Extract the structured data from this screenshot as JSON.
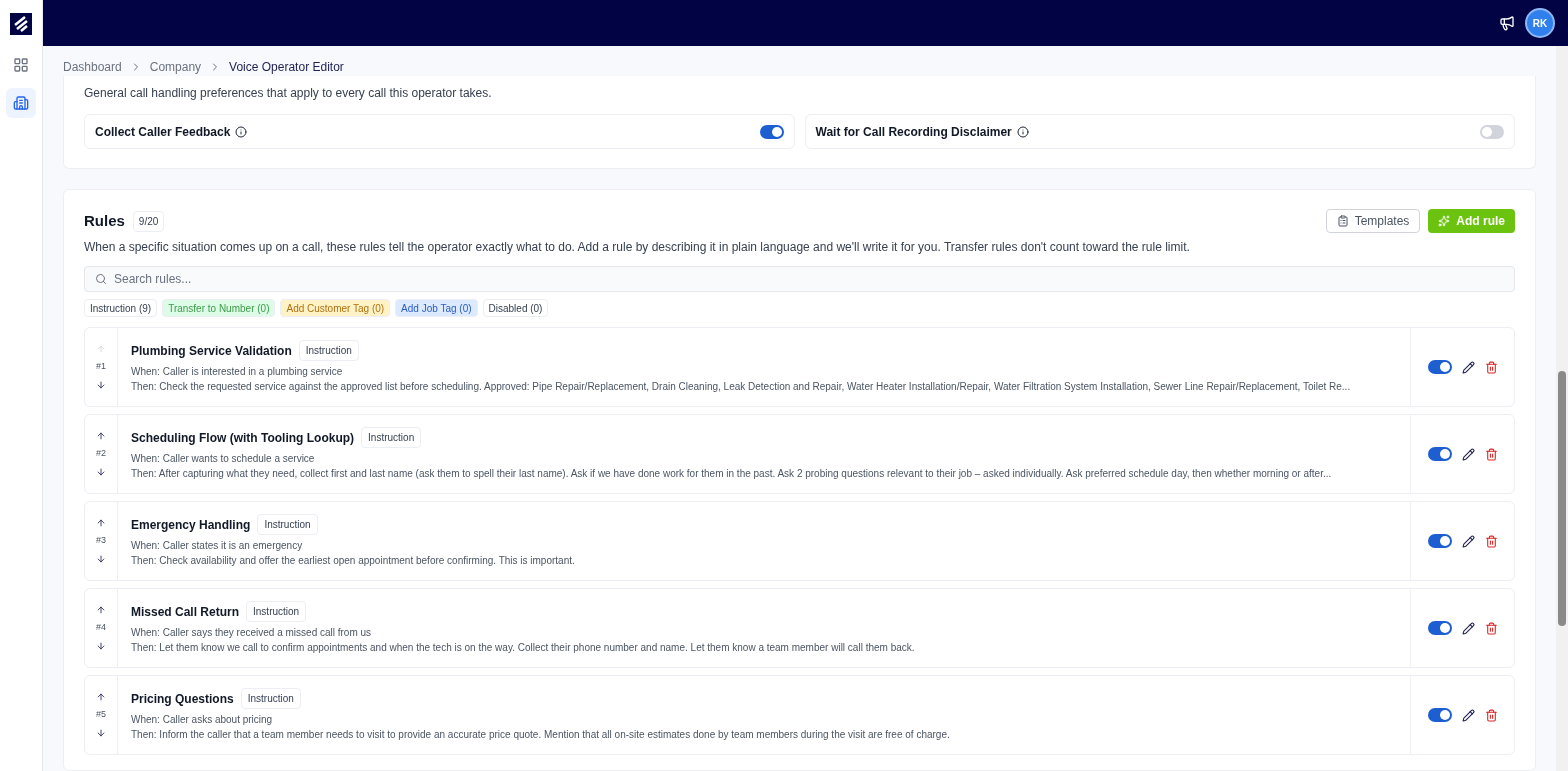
{
  "topbar": {
    "avatar": "RK"
  },
  "sidebar": {
    "items": [
      {
        "kind": "grid",
        "selected": false
      },
      {
        "kind": "building",
        "selected": true
      }
    ]
  },
  "breadcrumb": [
    "Dashboard",
    "Company",
    "Voice Operator Editor"
  ],
  "preferences": {
    "description": "General call handling preferences that apply to every call this operator takes.",
    "settings": [
      {
        "label": "Collect Caller Feedback",
        "on": true
      },
      {
        "label": "Wait for Call Recording Disclaimer",
        "on": false
      }
    ]
  },
  "rules": {
    "title": "Rules",
    "count": "9/20",
    "description": "When a specific situation comes up on a call, these rules tell the operator exactly what to do. Add a rule by describing it in plain language and we'll write it for you. Transfer rules don't count toward the rule limit.",
    "templates_button": "Templates",
    "add_button": "Add rule",
    "search": {
      "placeholder": "Search rules..."
    },
    "filters": [
      {
        "label": "Instruction (9)",
        "color": "#ffffff"
      },
      {
        "label": "Transfer to Number (0)",
        "color": "#dcfce7"
      },
      {
        "label": "Add Customer Tag (0)",
        "color": "#fef3c7"
      },
      {
        "label": "Add Job Tag (0)",
        "color": "#dbeafe"
      },
      {
        "label": "Disabled (0)",
        "color": "#ffffff"
      }
    ],
    "items": [
      {
        "number": "#1",
        "up_disabled": true,
        "title": "Plumbing Service Validation",
        "type": "Instruction",
        "when": "When: Caller is interested in a plumbing service",
        "then": "Then: Check the requested service against the approved list before scheduling. Approved: Pipe Repair/Replacement, Drain Cleaning, Leak Detection and Repair, Water Heater Installation/Repair, Water Filtration System Installation, Sewer Line Repair/Replacement, Toilet Re...",
        "enabled": true
      },
      {
        "number": "#2",
        "up_disabled": false,
        "title": "Scheduling Flow (with Tooling Lookup)",
        "type": "Instruction",
        "when": "When: Caller wants to schedule a service",
        "then": "Then: After capturing what they need, collect first and last name (ask them to spell their last name). Ask if we have done work for them in the past. Ask 2 probing questions relevant to their job – asked individually. Ask preferred schedule day, then whether morning or after...",
        "enabled": true
      },
      {
        "number": "#3",
        "up_disabled": false,
        "title": "Emergency Handling",
        "type": "Instruction",
        "when": "When: Caller states it is an emergency",
        "then": "Then: Check availability and offer the earliest open appointment before confirming. This is important.",
        "enabled": true
      },
      {
        "number": "#4",
        "up_disabled": false,
        "title": "Missed Call Return",
        "type": "Instruction",
        "when": "When: Caller says they received a missed call from us",
        "then": "Then: Let them know we call to confirm appointments and when the tech is on the way. Collect their phone number and name. Let them know a team member will call them back.",
        "enabled": true
      },
      {
        "number": "#5",
        "up_disabled": false,
        "title": "Pricing Questions",
        "type": "Instruction",
        "when": "When: Caller asks about pricing",
        "then": "Then: Inform the caller that a team member needs to visit to provide an accurate price quote. Mention that all on-site estimates done by team members during the visit are free of charge.",
        "enabled": true
      }
    ]
  }
}
